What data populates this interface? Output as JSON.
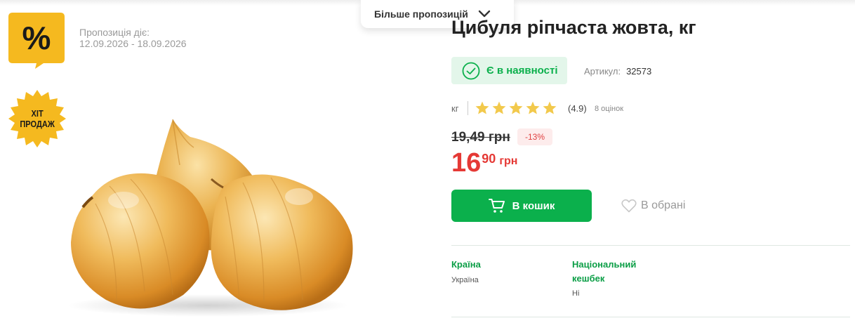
{
  "offer": {
    "label": "Пропозиція діє:",
    "dates": "12.09.2026 - 18.09.2026"
  },
  "badges": {
    "percent": "%",
    "hit_line1": "ХІТ",
    "hit_line2": "ПРОДАЖ"
  },
  "more_offers": {
    "label": "Більше пропозицій"
  },
  "product": {
    "title": "Цибуля ріпчаста жовта, кг",
    "stock_label": "Є в наявності",
    "article_label": "Артикул:",
    "article_value": "32573",
    "unit": "кг",
    "rating": "(4.9)",
    "reviews": "8 оцінок",
    "stars_filled": 5,
    "old_price": "19,49 грн",
    "discount": "-13%",
    "price_int": "16",
    "price_frac": "90",
    "price_currency": "грн"
  },
  "actions": {
    "cart_label": "В кошик",
    "favorite_label": "В обрані"
  },
  "attributes": [
    {
      "title": "Країна",
      "value": "Україна"
    },
    {
      "title": "Національний кешбек",
      "value": "Ні"
    }
  ],
  "colors": {
    "brand_green": "#0bb04c",
    "price_red": "#e53935",
    "badge_yellow": "#f5b91f",
    "star_yellow": "#f2c94c"
  }
}
